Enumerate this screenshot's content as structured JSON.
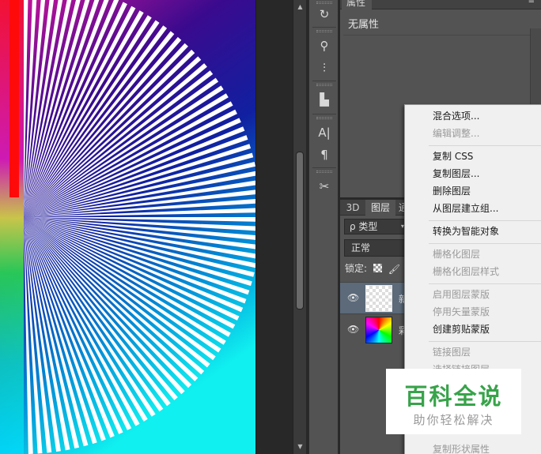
{
  "canvas": {
    "image": "radial-spokes-artwork",
    "colors": [
      "#ff0000",
      "#ff00ff",
      "#0000ff",
      "#00ffff",
      "#00ff00",
      "#ffff00"
    ]
  },
  "toolbar": {
    "tools": [
      "history-icon",
      "brush-settings-icon",
      "adjustments-icon",
      "clone-source-icon",
      "character-icon",
      "paragraph-icon",
      "tool-presets-icon"
    ],
    "glyphs": [
      "↻",
      "⚲",
      "⫶",
      "▙",
      "A|",
      "¶",
      "✂"
    ]
  },
  "properties": {
    "tab_label": "属性",
    "menu_icon": "≡",
    "empty_text": "无属性"
  },
  "layers": {
    "tabs": [
      "3D",
      "图层",
      "通"
    ],
    "filter_label": "ρ 类型",
    "filter_caret": "▾",
    "blend_mode": "正常",
    "lock_label": "锁定:",
    "rows": [
      {
        "name": "新",
        "thumb": "transparent"
      },
      {
        "name": "彩",
        "thumb": "color"
      }
    ]
  },
  "context_menu": {
    "items": [
      {
        "label": "混合选项...",
        "disabled": false
      },
      {
        "label": "编辑调整...",
        "disabled": true
      },
      {
        "label": "复制 CSS",
        "disabled": false
      },
      {
        "label": "复制图层...",
        "disabled": false
      },
      {
        "label": "删除图层",
        "disabled": false
      },
      {
        "label": "从图层建立组...",
        "disabled": false
      },
      {
        "label": "转换为智能对象",
        "disabled": false
      },
      {
        "label": "栅格化图层",
        "disabled": true
      },
      {
        "label": "栅格化图层样式",
        "disabled": true
      },
      {
        "label": "启用图层蒙版",
        "disabled": true
      },
      {
        "label": "停用矢量蒙版",
        "disabled": true
      },
      {
        "label": "创建剪贴蒙版",
        "disabled": false
      },
      {
        "label": "链接图层",
        "disabled": true
      },
      {
        "label": "选择链接图层",
        "disabled": true
      },
      {
        "label": "复制形状属性",
        "disabled": true
      }
    ]
  },
  "watermark": {
    "logo": "百科全说",
    "sub": "助你轻松解决"
  }
}
